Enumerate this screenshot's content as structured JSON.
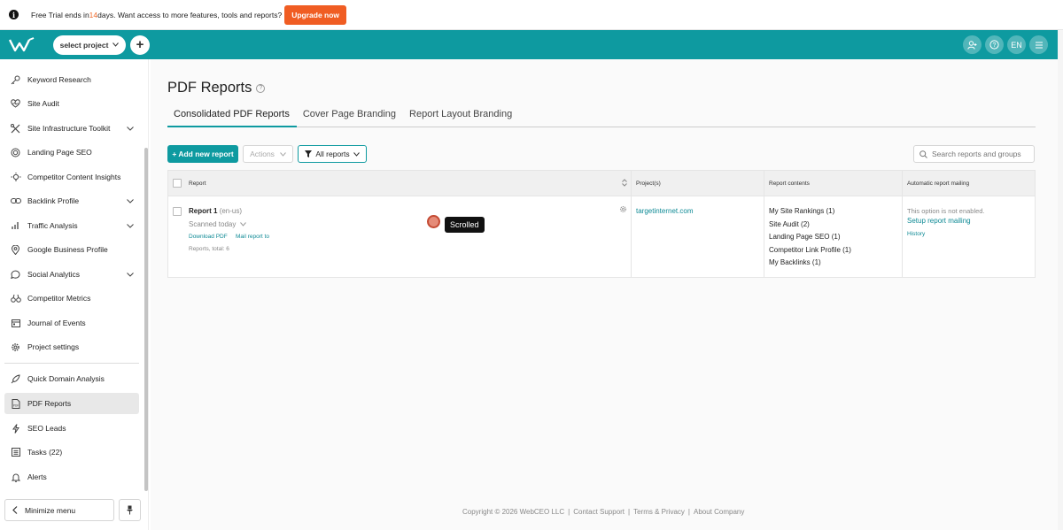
{
  "trial": {
    "prefix": "Free Trial ends in ",
    "days": "14",
    "suffix": " days. Want access to more features, tools and reports?",
    "upgrade": "Upgrade now"
  },
  "topbar": {
    "project": "select project",
    "lang": "EN"
  },
  "sidebar": {
    "items": [
      {
        "label": "Keyword Research",
        "icon": "key-icon"
      },
      {
        "label": "Site Audit",
        "icon": "heart-pulse-icon"
      },
      {
        "label": "Site Infrastructure Toolkit",
        "icon": "tools-icon",
        "expandable": true
      },
      {
        "label": "Landing Page SEO",
        "icon": "target-icon"
      },
      {
        "label": "Competitor Content Insights",
        "icon": "bulb-icon"
      },
      {
        "label": "Backlink Profile",
        "icon": "link-icon",
        "expandable": true
      },
      {
        "label": "Traffic Analysis",
        "icon": "bar-chart-icon",
        "expandable": true
      },
      {
        "label": "Google Business Profile",
        "icon": "map-pin-icon"
      },
      {
        "label": "Social Analytics",
        "icon": "chat-icon",
        "expandable": true
      },
      {
        "label": "Competitor Metrics",
        "icon": "binoculars-icon"
      },
      {
        "label": "Journal of Events",
        "icon": "calendar-icon"
      },
      {
        "label": "Project settings",
        "icon": "gear-icon"
      },
      {
        "label": "Quick Domain Analysis",
        "icon": "rocket-icon"
      },
      {
        "label": "PDF Reports",
        "icon": "pdf-icon",
        "active": true
      },
      {
        "label": "SEO Leads",
        "icon": "lightning-icon"
      },
      {
        "label": "Tasks (22)",
        "icon": "list-icon"
      },
      {
        "label": "Alerts",
        "icon": "bell-icon"
      }
    ],
    "minimize": "Minimize menu"
  },
  "main": {
    "title": "PDF Reports",
    "tabs": [
      "Consolidated PDF Reports",
      "Cover Page Branding",
      "Report Layout Branding"
    ],
    "add_report": "+ Add new report",
    "actions": "Actions",
    "all_reports": "All reports",
    "search_placeholder": "Search reports and groups"
  },
  "table": {
    "headers": [
      "Report",
      "Project(s)",
      "Report contents",
      "Automatic report mailing"
    ],
    "row": {
      "name": "Report 1",
      "locale": "(en-us)",
      "scanned": "Scanned today",
      "download": "Download PDF",
      "mail": "Mail report to",
      "total": "Reports, total: 6",
      "project": "targetinternet.com",
      "contents": [
        "My Site Rankings (1)",
        "Site Audit (2)",
        "Landing Page SEO (1)",
        "Competitor Link Profile (1)",
        "My Backlinks (1)"
      ],
      "mailing_status": "This option is not enabled.",
      "setup": "Setup report mailing",
      "history": "History"
    }
  },
  "tooltip": "Scrolled",
  "footer": {
    "copyright": "Copyright © 2026 WebCEO LLC",
    "links": [
      "Contact Support",
      "Terms & Privacy",
      "About Company"
    ]
  },
  "colors": {
    "brand": "#0e9aa0",
    "upgrade": "#f05d23"
  }
}
